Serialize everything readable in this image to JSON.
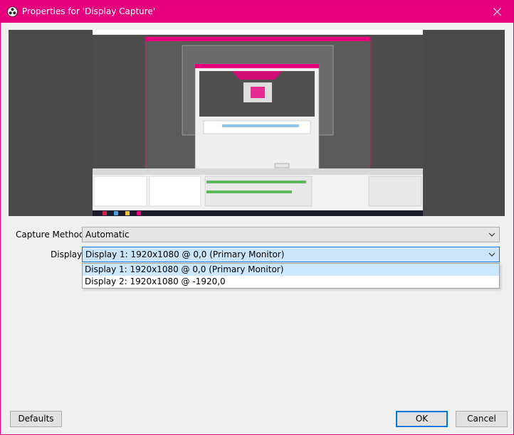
{
  "window": {
    "title": "Properties for 'Display Capture'",
    "accent": "#e6007e"
  },
  "titlebar": {
    "app_icon": "obs-logo-icon",
    "close_icon": "close-icon"
  },
  "form": {
    "capture_method_label": "Capture Method",
    "capture_method_value": "Automatic",
    "display_label": "Display",
    "display_value": "Display 1: 1920x1080 @ 0,0 (Primary Monitor)"
  },
  "dropdown": {
    "options": [
      "Display 1: 1920x1080 @ 0,0 (Primary Monitor)",
      "Display 2: 1920x1080 @ -1920,0"
    ],
    "selected_index": 0
  },
  "buttons": {
    "defaults": "Defaults",
    "ok": "OK",
    "cancel": "Cancel"
  }
}
